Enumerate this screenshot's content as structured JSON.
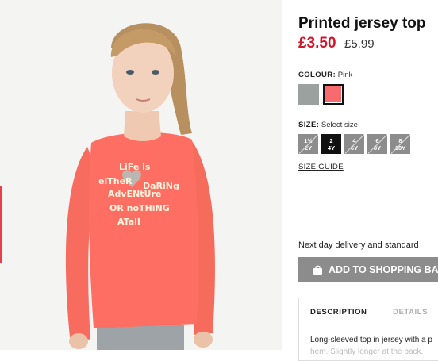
{
  "product": {
    "title": "Printed jersey top",
    "price_sale": "£3.50",
    "price_old": "£5.99",
    "shirt_print": [
      "LiFe is",
      "eiTheR",
      "DaRiNg",
      "AdvENtUre",
      "OR noTHiNG",
      "ATall"
    ]
  },
  "colour": {
    "label": "COLOUR:",
    "value": "Pink",
    "swatches": [
      {
        "name": "grey",
        "color": "#9aa19e"
      },
      {
        "name": "pink",
        "color": "#f76a6d"
      }
    ]
  },
  "size": {
    "label": "SIZE:",
    "placeholder": "Select size",
    "options": [
      {
        "top": "1½",
        "bottom": "2Y",
        "available": false
      },
      {
        "top": "2",
        "bottom": "4Y",
        "available": true,
        "selected": true
      },
      {
        "top": "4",
        "bottom": "6Y",
        "available": false
      },
      {
        "top": "6",
        "bottom": "8Y",
        "available": false
      },
      {
        "top": "8",
        "bottom": "10Y",
        "available": false
      }
    ],
    "guide_label": "SIZE GUIDE"
  },
  "delivery": {
    "text": "Next day delivery and standard"
  },
  "cart": {
    "button_label": "ADD TO SHOPPING BA",
    "icon": "shopping-bag-icon"
  },
  "details": {
    "tabs": [
      {
        "label": "DESCRIPTION",
        "active": true
      },
      {
        "label": "DETAILS",
        "active": false
      }
    ],
    "description_line1": "Long-sleeved top in jersey with a p",
    "description_line2": "hem. Slightly longer at the back."
  }
}
